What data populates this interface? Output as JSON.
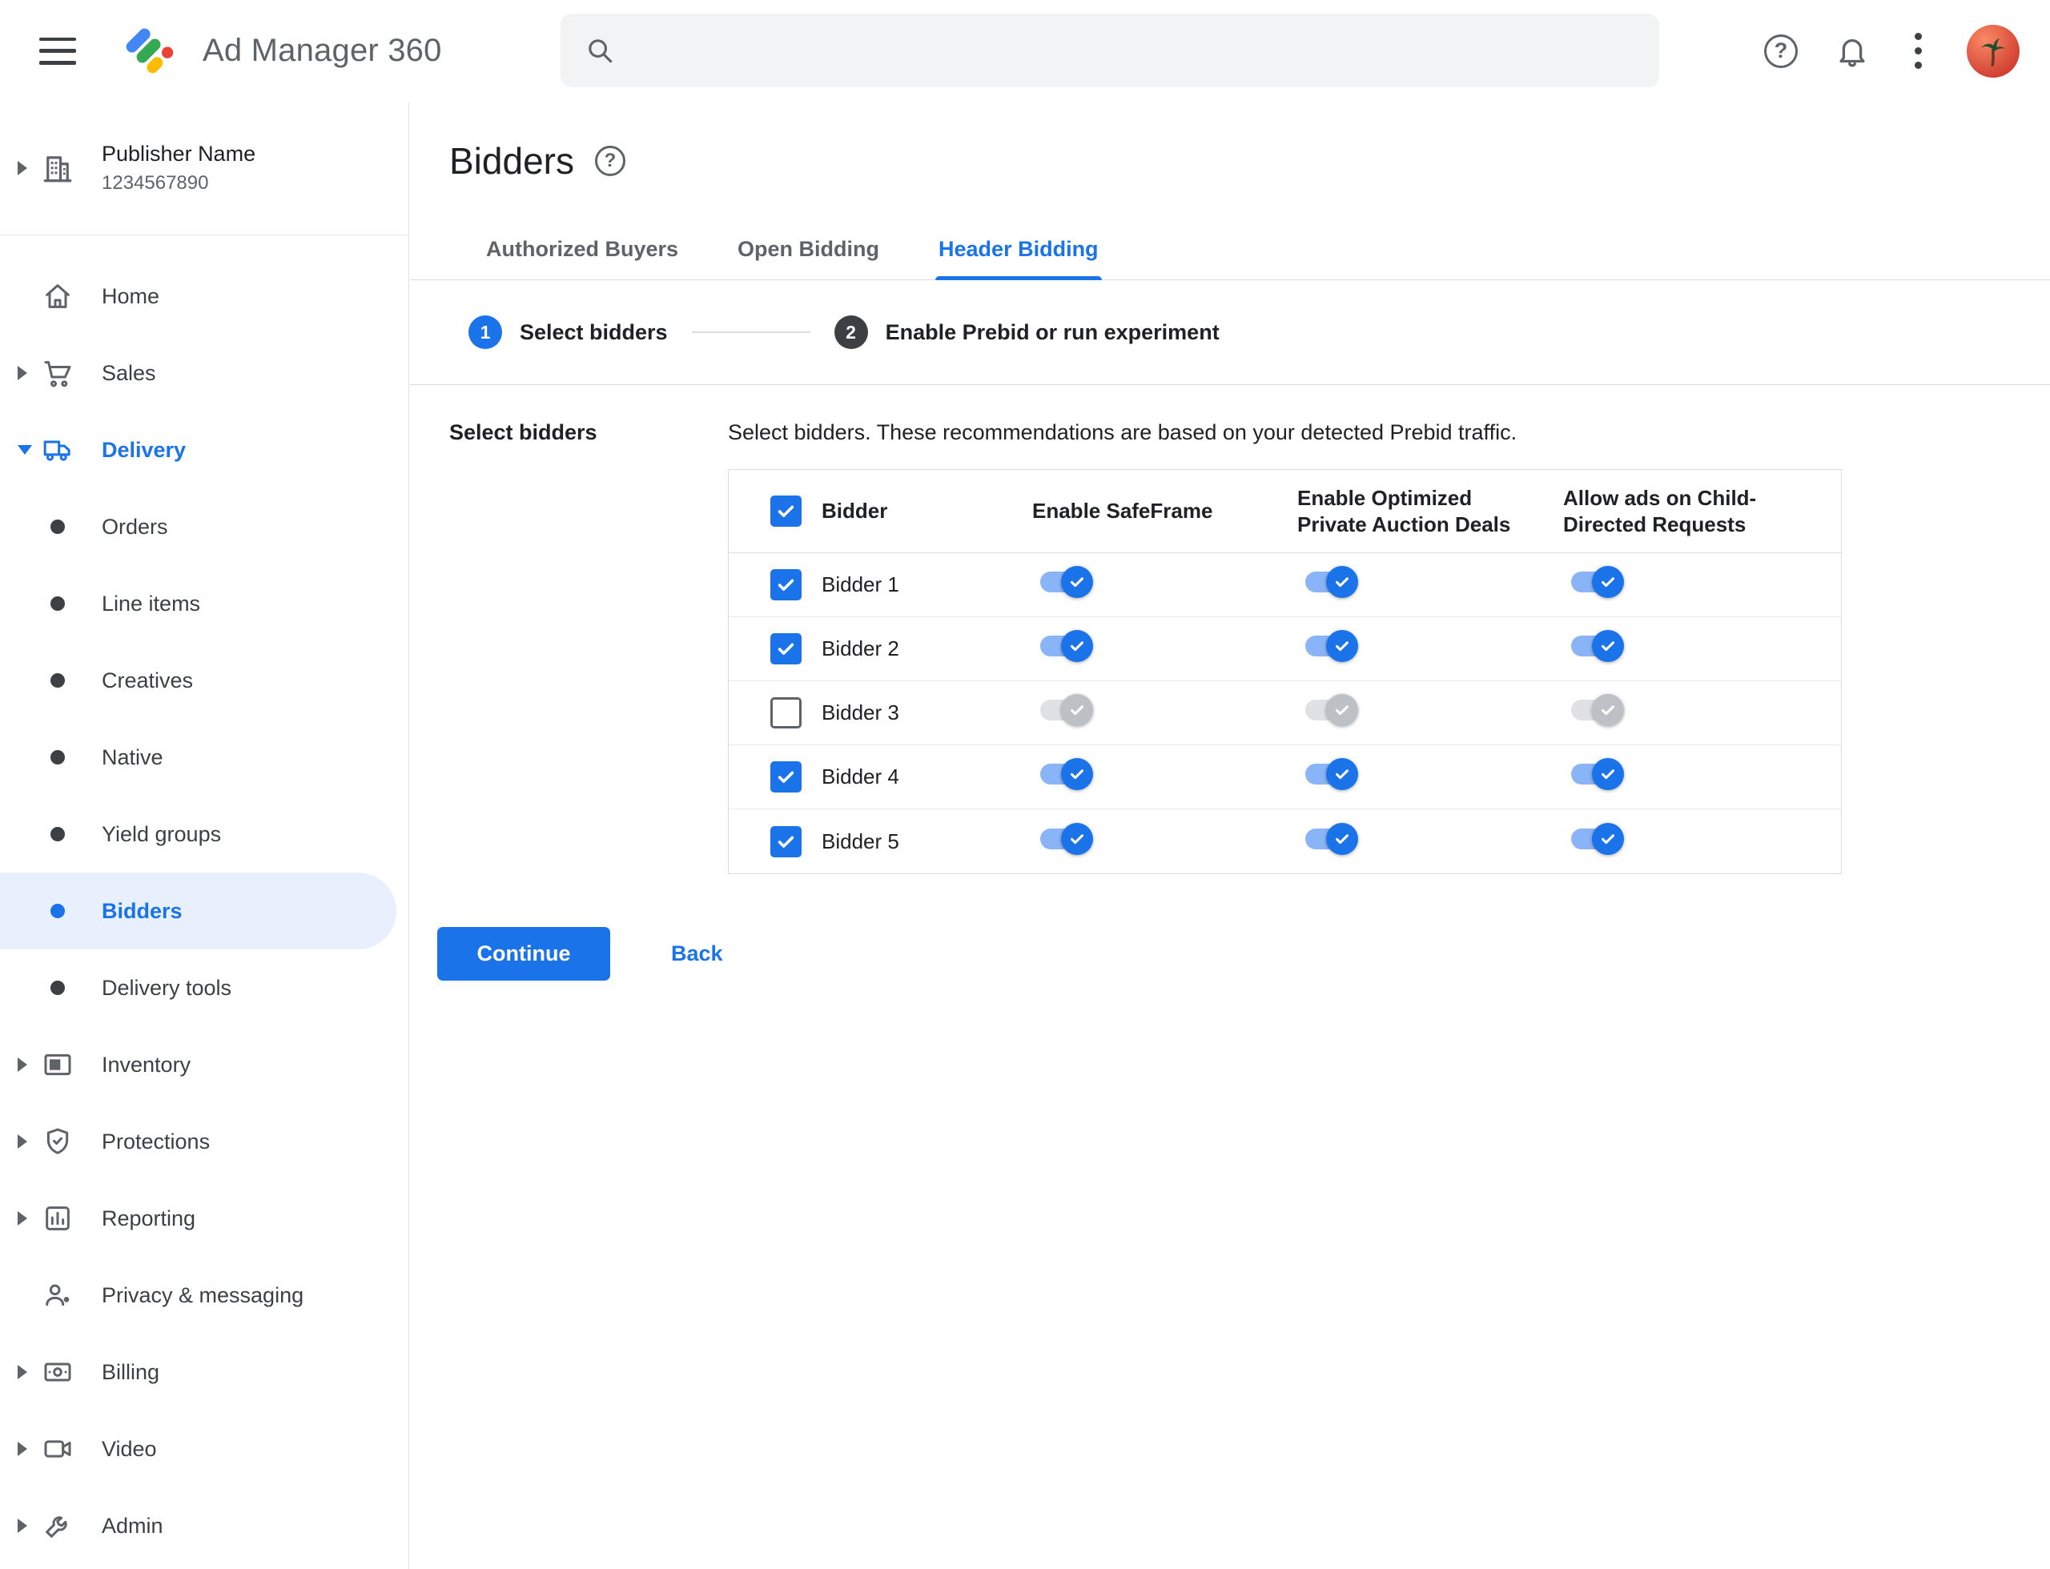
{
  "topbar": {
    "app_title": "Ad Manager 360",
    "search": {
      "value": ""
    }
  },
  "sidebar": {
    "publisher": {
      "name": "Publisher Name",
      "id": "1234567890"
    },
    "items": [
      {
        "label": "Home",
        "icon": "home-icon",
        "arrow": "none"
      },
      {
        "label": "Sales",
        "icon": "cart-icon",
        "arrow": "right"
      },
      {
        "label": "Delivery",
        "icon": "truck-icon",
        "arrow": "down",
        "expanded": true
      },
      {
        "label": "Orders",
        "icon": "bullet",
        "indent": true
      },
      {
        "label": "Line items",
        "icon": "bullet",
        "indent": true
      },
      {
        "label": "Creatives",
        "icon": "bullet",
        "indent": true
      },
      {
        "label": "Native",
        "icon": "bullet",
        "indent": true
      },
      {
        "label": "Yield groups",
        "icon": "bullet",
        "indent": true
      },
      {
        "label": "Bidders",
        "icon": "bullet",
        "indent": true,
        "selected": true
      },
      {
        "label": "Delivery tools",
        "icon": "bullet",
        "indent": true
      },
      {
        "label": "Inventory",
        "icon": "inventory-icon",
        "arrow": "right"
      },
      {
        "label": "Protections",
        "icon": "shield-icon",
        "arrow": "right"
      },
      {
        "label": "Reporting",
        "icon": "report-icon",
        "arrow": "right"
      },
      {
        "label": "Privacy & messaging",
        "icon": "person-icon",
        "arrow": "none"
      },
      {
        "label": "Billing",
        "icon": "billing-icon",
        "arrow": "right"
      },
      {
        "label": "Video",
        "icon": "video-icon",
        "arrow": "right"
      },
      {
        "label": "Admin",
        "icon": "admin-icon",
        "arrow": "right"
      }
    ]
  },
  "page": {
    "title": "Bidders",
    "tabs": [
      {
        "label": "Authorized Buyers",
        "active": false
      },
      {
        "label": "Open Bidding",
        "active": false
      },
      {
        "label": "Header Bidding",
        "active": true
      }
    ],
    "stepper": [
      {
        "number": "1",
        "label": "Select bidders",
        "state": "current"
      },
      {
        "number": "2",
        "label": "Enable Prebid or run experiment",
        "state": "next"
      }
    ]
  },
  "form": {
    "section_label": "Select bidders",
    "description": "Select bidders. These recommendations are based on your detected Prebid traffic.",
    "table": {
      "select_all": true,
      "columns": [
        "Bidder",
        "Enable SafeFrame",
        "Enable Optimized Private Auction Deals",
        "Allow ads on Child-Directed Requests"
      ],
      "rows": [
        {
          "name": "Bidder 1",
          "selected": true,
          "safeframe": true,
          "optimized_deals": true,
          "child_directed": true
        },
        {
          "name": "Bidder 2",
          "selected": true,
          "safeframe": true,
          "optimized_deals": true,
          "child_directed": true
        },
        {
          "name": "Bidder 3",
          "selected": false,
          "safeframe": false,
          "optimized_deals": false,
          "child_directed": false
        },
        {
          "name": "Bidder 4",
          "selected": true,
          "safeframe": true,
          "optimized_deals": true,
          "child_directed": true
        },
        {
          "name": "Bidder 5",
          "selected": true,
          "safeframe": true,
          "optimized_deals": true,
          "child_directed": true
        }
      ]
    },
    "actions": {
      "continue": "Continue",
      "back": "Back"
    }
  },
  "colors": {
    "accent": "#1a73e8",
    "selected_item_bg": "#e8f0fe",
    "toggle_on_track": "#8ab4f8",
    "toggle_off_thumb": "#bdc1c6",
    "step_next_bg": "#3c4043",
    "text_primary": "#202124",
    "text_secondary": "#5f6368",
    "border": "#dadce0"
  }
}
